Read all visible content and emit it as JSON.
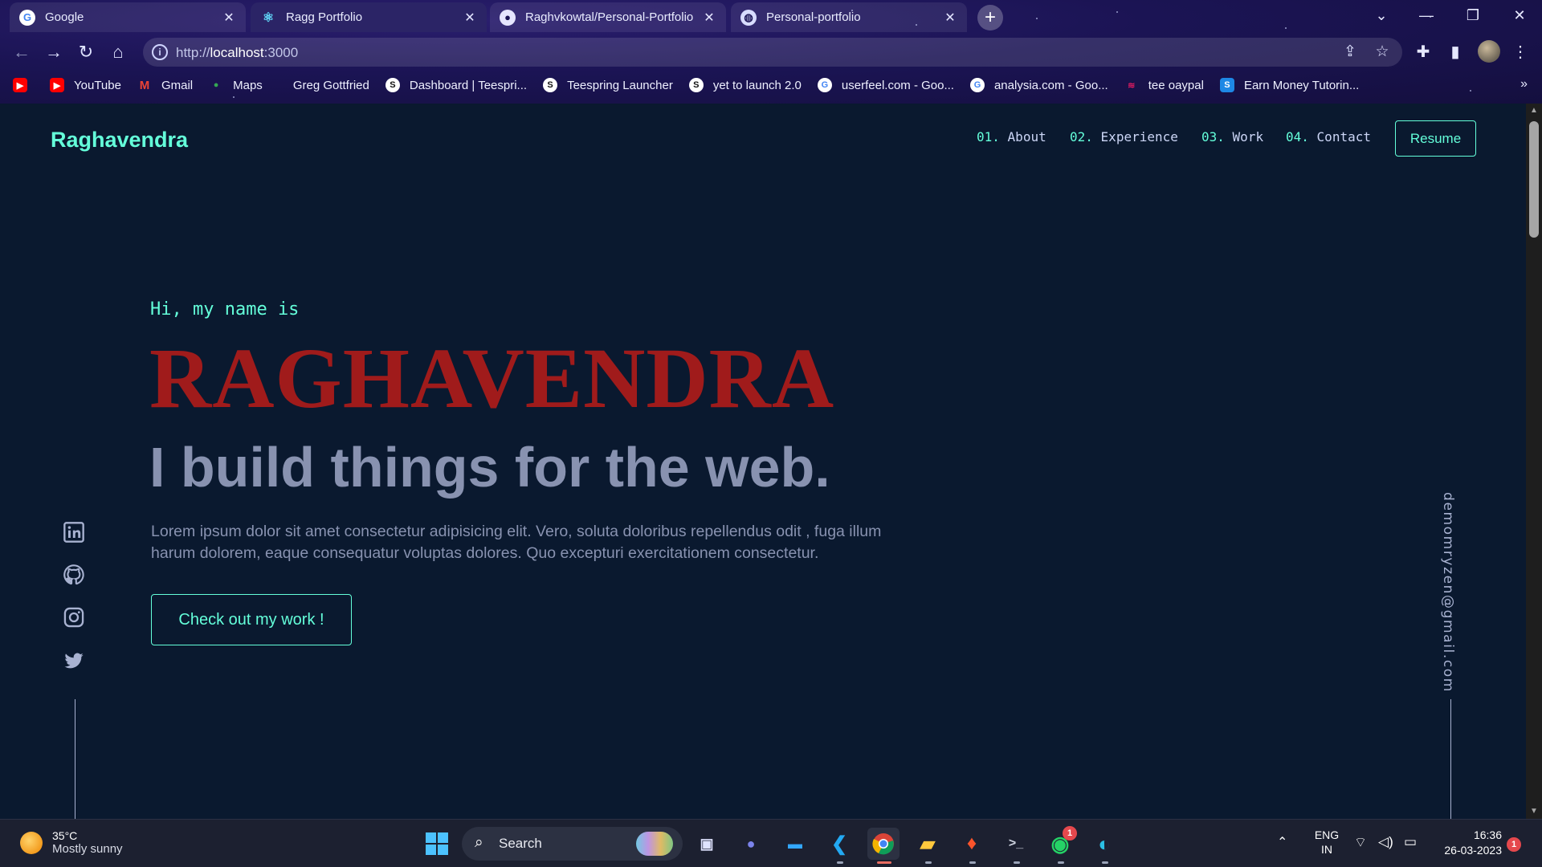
{
  "browser": {
    "tabs": [
      {
        "title": "Google",
        "favicon": "google-icon",
        "active": false
      },
      {
        "title": "Ragg Portfolio",
        "favicon": "react-icon",
        "active": true
      },
      {
        "title": "Raghvkowtal/Personal-Portfolio",
        "favicon": "github-icon",
        "active": false
      },
      {
        "title": "Personal-portfolio",
        "favicon": "globe-icon",
        "active": false
      }
    ],
    "address": {
      "scheme": "http://",
      "host": "localhost",
      "port": ":3000"
    },
    "bookmarks": [
      {
        "label": "",
        "icon": "youtube-icon",
        "color": "#ff0000"
      },
      {
        "label": "YouTube",
        "icon": "youtube-icon",
        "color": "#ff0000"
      },
      {
        "label": "Gmail",
        "icon": "gmail-icon",
        "color": "#ea4335"
      },
      {
        "label": "Maps",
        "icon": "maps-pin-icon",
        "color": "#34a853"
      },
      {
        "label": "Greg Gottfried",
        "icon": "",
        "color": ""
      },
      {
        "label": "Dashboard | Teespri...",
        "icon": "teespring-icon",
        "color": "#111111"
      },
      {
        "label": "Teespring Launcher",
        "icon": "teespring-icon",
        "color": "#111111"
      },
      {
        "label": "yet to launch 2.0",
        "icon": "teespring-icon",
        "color": "#111111"
      },
      {
        "label": "userfeel.com - Goo...",
        "icon": "google-icon",
        "color": "#ffffff"
      },
      {
        "label": "analysia.com - Goo...",
        "icon": "google-icon",
        "color": "#ffffff"
      },
      {
        "label": "tee oaypal",
        "icon": "lips-icon",
        "color": "#d81b60"
      },
      {
        "label": "Earn Money Tutorin...",
        "icon": "s-logo-icon",
        "color": "#1e88e5"
      }
    ],
    "bookmarks_overflow": "»"
  },
  "site": {
    "logo": "Raghavendra",
    "nav": [
      {
        "num": "01.",
        "label": "About"
      },
      {
        "num": "02.",
        "label": "Experience"
      },
      {
        "num": "03.",
        "label": "Work"
      },
      {
        "num": "04.",
        "label": "Contact"
      }
    ],
    "resume_label": "Resume",
    "greeting": "Hi, my name is",
    "name": "RAGHAVENDRA",
    "tagline": "I build things for the web.",
    "description": "Lorem ipsum dolor sit amet consectetur adipisicing elit. Vero, soluta doloribus repellendus odit , fuga illum harum dolorem, eaque consequatur voluptas dolores. Quo excepturi exercitationem consectetur.",
    "cta_label": "Check out my work !",
    "socials": [
      "linkedin-icon",
      "github-icon",
      "instagram-icon",
      "twitter-icon"
    ],
    "email": "demomryzen@gmail.com",
    "colors": {
      "accent": "#64ffda",
      "background": "#0a192f",
      "name": "#a01b1b",
      "muted": "#8892b0"
    }
  },
  "taskbar": {
    "weather": {
      "temp": "35°C",
      "condition": "Mostly sunny"
    },
    "search_label": "Search",
    "apps": [
      "task-view-icon",
      "teams-chat-icon",
      "remote-desktop-icon",
      "vscode-icon",
      "chrome-icon",
      "file-explorer-icon",
      "brave-icon",
      "terminal-icon",
      "whatsapp-icon",
      "edge-icon"
    ],
    "whatsapp_badge": "1",
    "lang": {
      "line1": "ENG",
      "line2": "IN"
    },
    "clock": {
      "time": "16:36",
      "date": "26-03-2023"
    },
    "notification_count": "1"
  }
}
